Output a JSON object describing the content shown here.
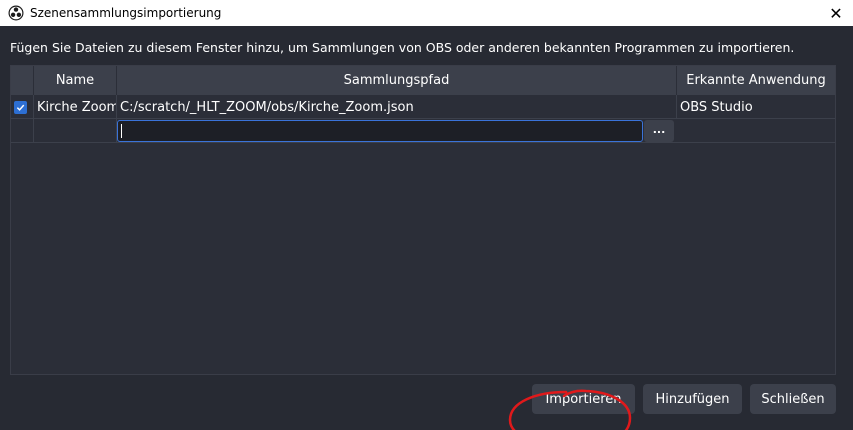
{
  "window": {
    "title": "Szenensammlungsimportierung",
    "close_glyph": "✕"
  },
  "info_text": "Fügen Sie Dateien zu diesem Fenster hinzu, um Sammlungen von OBS oder anderen bekannten Programmen zu importieren.",
  "table": {
    "columns": [
      "",
      "Name",
      "Sammlungspfad",
      "Erkannte Anwendung"
    ],
    "rows": [
      {
        "checked": true,
        "name": "Kirche Zoom",
        "path": "C:/scratch/_HLT_ZOOM/obs/Kirche_Zoom.json",
        "app": "OBS Studio"
      }
    ],
    "new_row": {
      "path_value": "",
      "browse_label": "..."
    }
  },
  "buttons": {
    "import": "Importieren",
    "add": "Hinzufügen",
    "close": "Schließen"
  },
  "colors": {
    "background": "#272a33",
    "accent": "#2d6fd3",
    "annotation": "#e0191b"
  },
  "icons": {
    "app": "obs-logo-icon",
    "check": "checkmark-icon"
  }
}
